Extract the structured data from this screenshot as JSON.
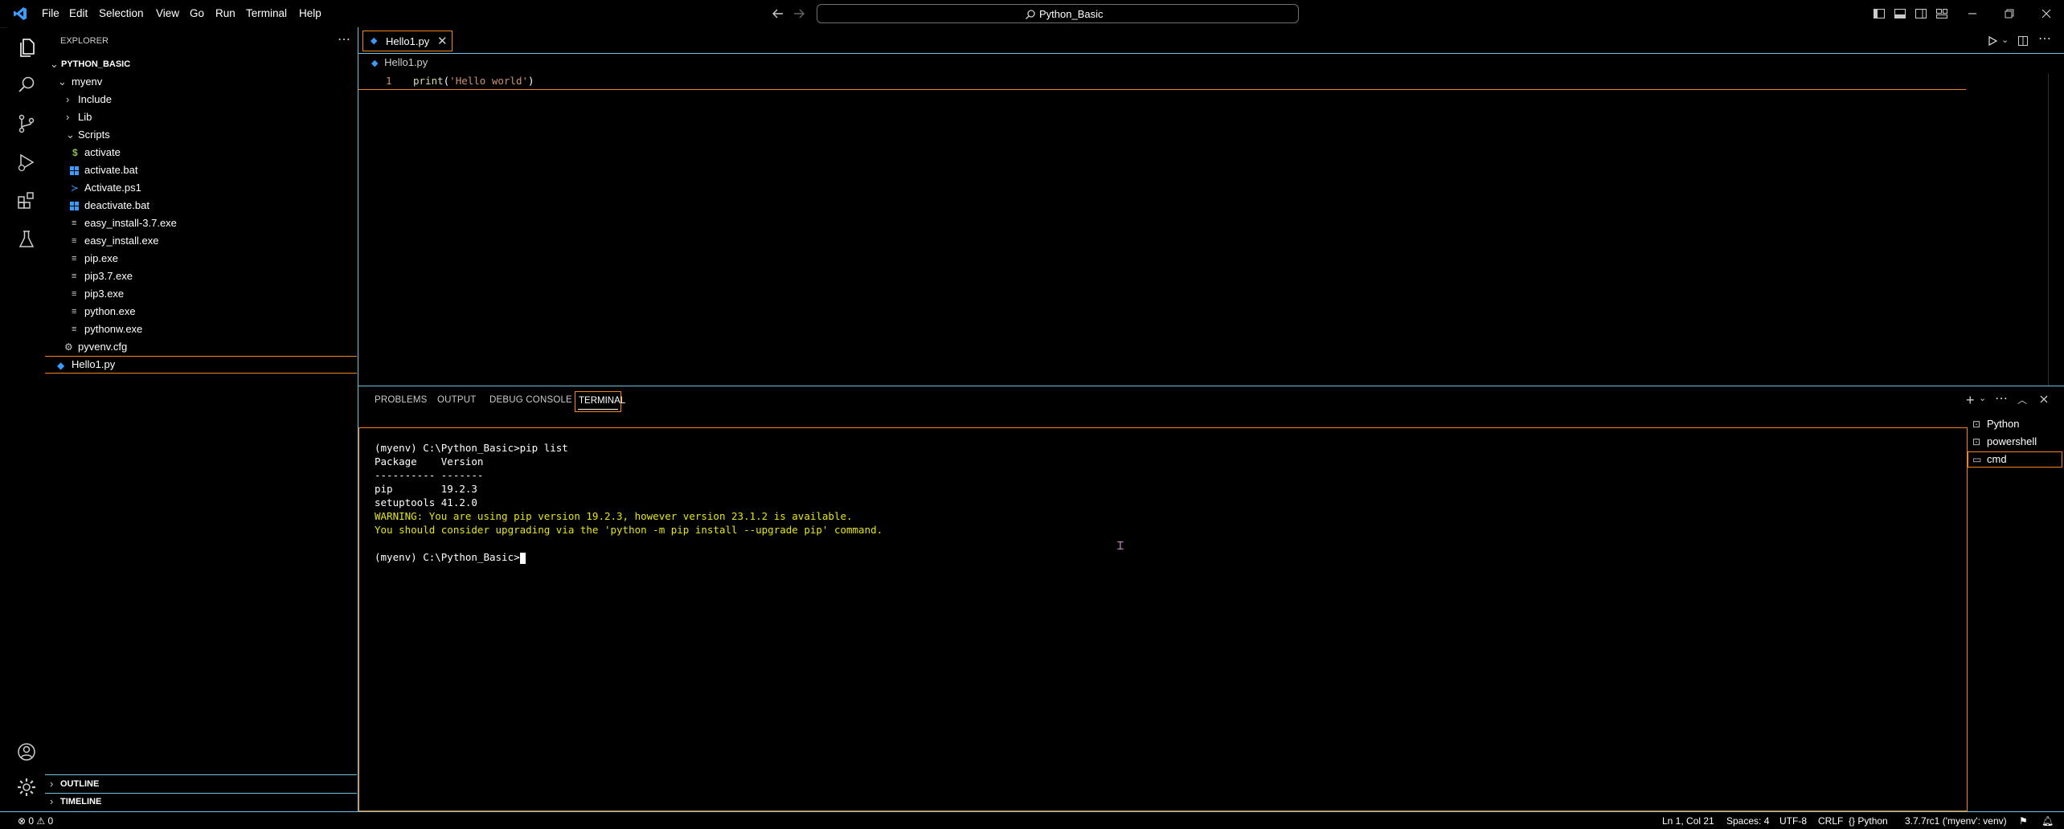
{
  "menu": [
    "File",
    "Edit",
    "Selection",
    "View",
    "Go",
    "Run",
    "Terminal",
    "Help"
  ],
  "search": {
    "text": "Python_Basic"
  },
  "explorer": {
    "header": "EXPLORER",
    "workspace": "PYTHON_BASIC",
    "items": [
      {
        "label": "myenv",
        "icon": "chevron-down"
      },
      {
        "label": "Include",
        "icon": "chevron-right"
      },
      {
        "label": "Lib",
        "icon": "chevron-right"
      },
      {
        "label": "Scripts",
        "icon": "chevron-down"
      },
      {
        "label": "activate",
        "icon": "dollar"
      },
      {
        "label": "activate.bat",
        "icon": "windows"
      },
      {
        "label": "Activate.ps1",
        "icon": "powershell"
      },
      {
        "label": "deactivate.bat",
        "icon": "windows"
      },
      {
        "label": "easy_install-3.7.exe",
        "icon": "file-lines"
      },
      {
        "label": "easy_install.exe",
        "icon": "file-lines"
      },
      {
        "label": "pip.exe",
        "icon": "file-lines"
      },
      {
        "label": "pip3.7.exe",
        "icon": "file-lines"
      },
      {
        "label": "pip3.exe",
        "icon": "file-lines"
      },
      {
        "label": "python.exe",
        "icon": "file-lines"
      },
      {
        "label": "pythonw.exe",
        "icon": "file-lines"
      },
      {
        "label": "pyvenv.cfg",
        "icon": "gear"
      },
      {
        "label": "Hello1.py",
        "icon": "python"
      }
    ],
    "outline": "OUTLINE",
    "timeline": "TIMELINE"
  },
  "editor": {
    "tab": "Hello1.py",
    "breadcrumb": "Hello1.py",
    "line_number": "1",
    "code": {
      "fn": "print",
      "open": "(",
      "str": "'Hello world'",
      "close": ")"
    }
  },
  "panel": {
    "tabs": [
      "PROBLEMS",
      "OUTPUT",
      "DEBUG CONSOLE",
      "TERMINAL"
    ],
    "terminal_lines": [
      "(myenv) C:\\Python_Basic>pip list",
      "Package    Version",
      "---------- -------",
      "pip        19.2.3",
      "setuptools 41.2.0",
      "WARNING: You are using pip version 19.2.3, however version 23.1.2 is available.",
      "You should consider upgrading via the 'python -m pip install --upgrade pip' command.",
      "",
      "(myenv) C:\\Python_Basic>"
    ],
    "terminals": [
      "Python",
      "powershell",
      "cmd"
    ]
  },
  "status": {
    "problems": "0",
    "warnings": "0",
    "position": "Ln 1, Col 21",
    "spaces": "Spaces: 4",
    "encoding": "UTF-8",
    "eol": "CRLF",
    "language": "Python",
    "interpreter": "3.7.7rc1 ('myenv': venv)"
  },
  "colors": {
    "accent_border": "#6fc3df",
    "focus_border": "#f38518",
    "string": "#ce9178",
    "function": "#dcdcaa",
    "warning": "#e5e510",
    "vscode_blue": "#3b9cff"
  }
}
